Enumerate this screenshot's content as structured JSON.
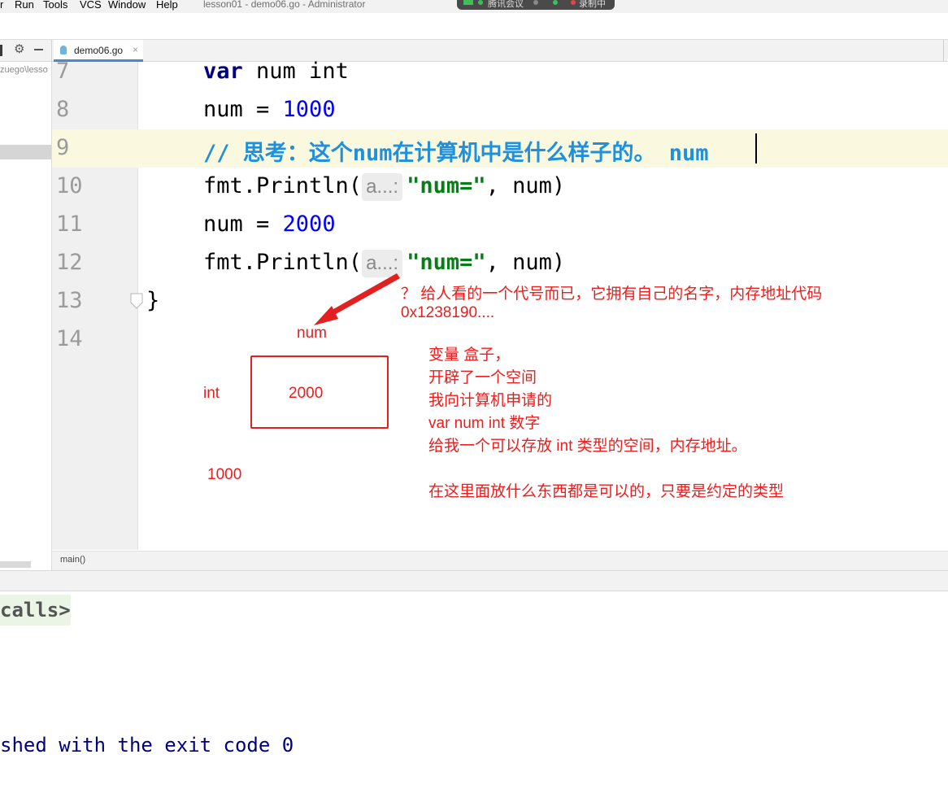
{
  "menu": {
    "items": [
      "r",
      "Run",
      "Tools",
      "VCS",
      "Window",
      "Help"
    ]
  },
  "window_title": "lesson01 - demo06.go - Administrator",
  "meeting_bar": {
    "app_label": "腾讯会议",
    "recording_label": "录制中"
  },
  "project": {
    "path_text": "zuego\\lesso"
  },
  "tab": {
    "filename": "demo06.go",
    "close": "×"
  },
  "gutter": {
    "line_numbers": [
      "7",
      "8",
      "9",
      "10",
      "11",
      "12",
      "13",
      "14"
    ]
  },
  "code": {
    "line7": {
      "kw": "var",
      "rest": " num int"
    },
    "line8": {
      "var": "num = ",
      "num": "1000"
    },
    "line9": {
      "comment": "// 思考：这个num在计算机中是什么样子的。 num"
    },
    "line10": {
      "func": "fmt.Println(",
      "hint": "a...:",
      "str": "\"num=\"",
      "tail": ", num)"
    },
    "line11": {
      "var": "num = ",
      "num": "2000"
    },
    "line12": {
      "func": "fmt.Println(",
      "hint": "a...:",
      "str": "\"num=\"",
      "tail": ", num)"
    },
    "line13": {
      "brace": "}"
    }
  },
  "breadcrumb": {
    "label": "main()"
  },
  "annotations": {
    "question_line1": "？ 给人看的一个代号而已，它拥有自己的名字，内存地址代码",
    "question_line2": "0x1238190....",
    "num_label": "num",
    "int_label": "int",
    "box_value": "2000",
    "old_value": "1000",
    "notes": [
      "变量  盒子，",
      "开辟了一个空间",
      "我向计算机申请的",
      "var num int  数字",
      "给我一个可以存放 int 类型的空间，内存地址。"
    ],
    "final_note": "在这里面放什么东西都是可以的，只要是约定的类型"
  },
  "console": {
    "calls_text": "calls>",
    "exit_text": "shed with the exit code 0"
  },
  "colors": {
    "annotation_red": "#ee1c1c",
    "keyword": "#000080",
    "number": "#0000ff",
    "string": "#067d17",
    "comment": "#1e90dd",
    "current_line": "#fbf8e0"
  }
}
